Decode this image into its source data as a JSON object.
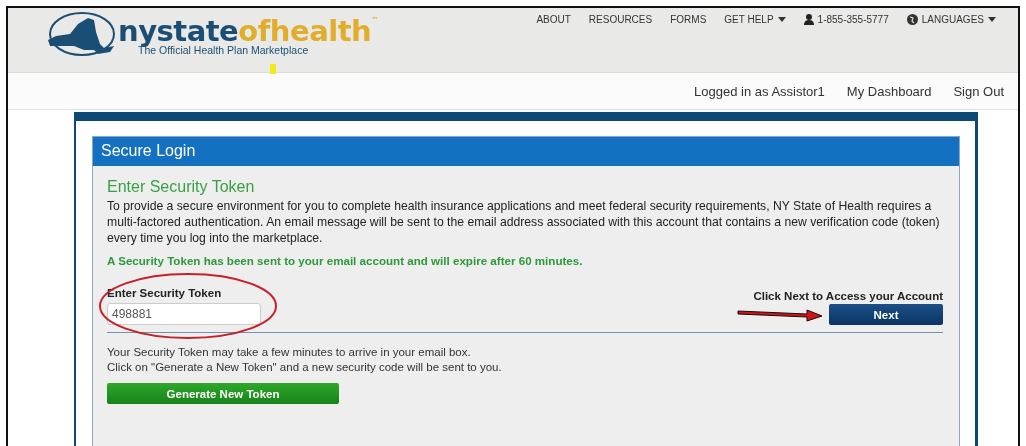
{
  "logo": {
    "parts": [
      {
        "text": "nystate",
        "kind": "primary"
      },
      {
        "text": "ofhealth",
        "kind": "accent"
      }
    ],
    "trademark": "™",
    "tagline": "The Official Health Plan Marketplace"
  },
  "top_nav": [
    {
      "label": "ABOUT",
      "kind": "link"
    },
    {
      "label": "RESOURCES",
      "kind": "link"
    },
    {
      "label": "FORMS",
      "kind": "link"
    },
    {
      "label": "GET HELP",
      "kind": "dropdown"
    },
    {
      "label": "1-855-355-5777",
      "kind": "phone"
    },
    {
      "label": "LANGUAGES",
      "kind": "language"
    }
  ],
  "user_bar": [
    "Logged in as Assistor1",
    "My Dashboard",
    "Sign Out"
  ],
  "panel": {
    "title": "Secure Login",
    "heading": "Enter Security Token",
    "intro": "To provide a secure environment for you to complete health insurance applications and meet federal security requirements, NY State of Health requires a multi-factored authentication. An email message will be sent to the email address associated with this account that contains a new verification code (token) every time you log into the marketplace.",
    "notice": "A Security Token has been sent to your email account and will expire after 60 minutes.",
    "token_field": {
      "label": "Enter Security Token",
      "value": "498881"
    },
    "next_hint": "Click Next to Access your Account",
    "next_button": "Next",
    "help_lines": [
      "Your Security Token may take a few minutes to arrive in your email box.",
      "Click on \"Generate a New Token\" and a new security code will be sent to you."
    ],
    "generate_button": "Generate New Token"
  }
}
